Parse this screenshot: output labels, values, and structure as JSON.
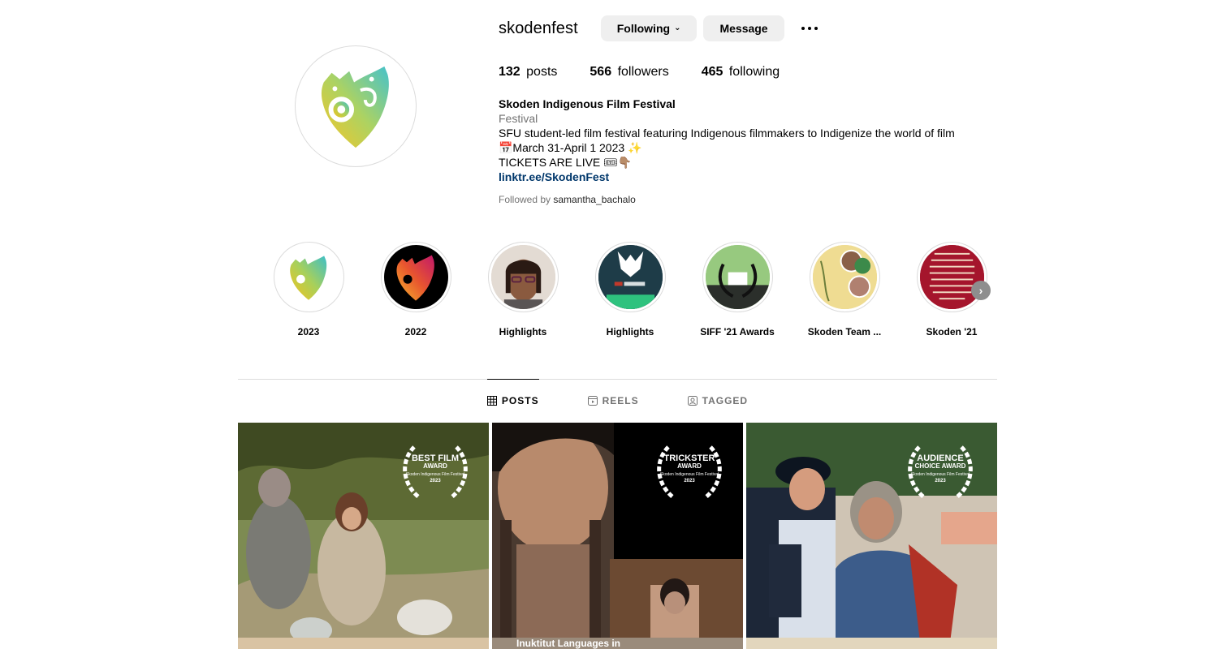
{
  "profile": {
    "username": "skodenfest",
    "following_label": "Following",
    "message_label": "Message",
    "stats": {
      "posts_count": "132",
      "posts_label": "posts",
      "followers_count": "566",
      "followers_label": "followers",
      "following_count": "465",
      "following_label": "following"
    },
    "bio": {
      "full_name": "Skoden Indigenous Film Festival",
      "category": "Festival",
      "line1": "SFU student-led film festival featuring Indigenous filmmakers to Indigenize the world of film",
      "line2": "📅March 31-April 1 2023 ✨",
      "line3": "TICKETS ARE LIVE 🎟👇🏽",
      "link": "linktr.ee/SkodenFest",
      "followed_by_prefix": "Followed by",
      "followed_by_user": "samantha_bachalo"
    }
  },
  "highlights": [
    {
      "label": "2023"
    },
    {
      "label": "2022"
    },
    {
      "label": "Highlights"
    },
    {
      "label": "Highlights"
    },
    {
      "label": "SIFF '21 Awards"
    },
    {
      "label": "Skoden Team ..."
    },
    {
      "label": "Skoden '21"
    }
  ],
  "tabs": [
    {
      "label": "POSTS",
      "active": true
    },
    {
      "label": "REELS",
      "active": false
    },
    {
      "label": "TAGGED",
      "active": false
    }
  ],
  "posts": [
    {
      "award_line1": "BEST FILM",
      "award_line2": "AWARD",
      "award_line3": "Skoden Indigenous Film Festival",
      "award_year": "2023"
    },
    {
      "award_line1": "TRICKSTER",
      "award_line2": "AWARD",
      "award_line3": "Skoden Indigenous Film Festival",
      "award_year": "2023",
      "caption": "Inuktitut Languages in"
    },
    {
      "award_line1": "AUDIENCE",
      "award_line2": "CHOICE AWARD",
      "award_line3": "Skoden Indigenous Film Festival",
      "award_year": "2023"
    }
  ],
  "colors": {
    "button_bg": "#efefef",
    "link": "#00376b",
    "muted": "#737373",
    "border": "#dbdbdb"
  }
}
